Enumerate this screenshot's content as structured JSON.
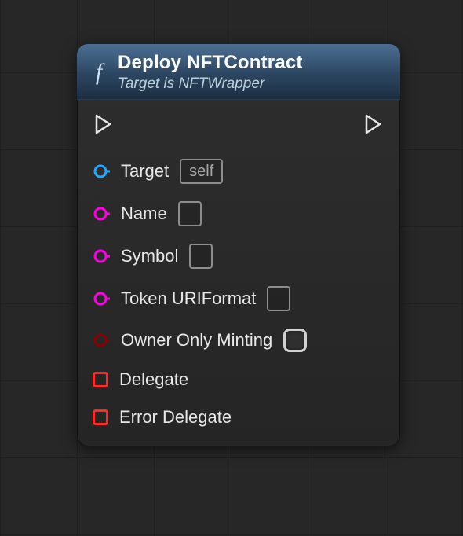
{
  "header": {
    "title": "Deploy NFTContract",
    "subtitle": "Target is NFTWrapper",
    "function_glyph": "f"
  },
  "pins": {
    "target": {
      "label": "Target",
      "value": "self",
      "color": "#1fa9ff"
    },
    "name": {
      "label": "Name",
      "value": "",
      "color": "#ff00e6"
    },
    "symbol": {
      "label": "Symbol",
      "value": "",
      "color": "#ff00e6"
    },
    "token_uri_format": {
      "label": "Token URIFormat",
      "value": "",
      "color": "#ff00e6"
    },
    "owner_only_minting": {
      "label": "Owner Only Minting",
      "checked": false,
      "color": "#8a0000"
    },
    "delegate": {
      "label": "Delegate"
    },
    "error_delegate": {
      "label": "Error Delegate"
    }
  }
}
